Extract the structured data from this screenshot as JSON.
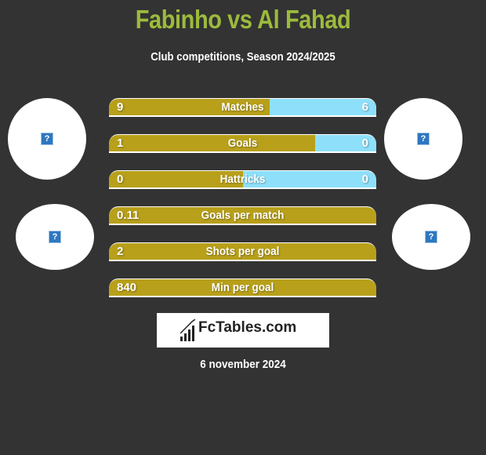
{
  "header": {
    "title": "Fabinho vs Al Fahad",
    "subtitle": "Club competitions, Season 2024/2025"
  },
  "players": {
    "left": {
      "name": "Fabinho",
      "avatar_icon": "missing-image-icon",
      "club_icon": "missing-image-icon"
    },
    "right": {
      "name": "Al Fahad",
      "avatar_icon": "missing-image-icon",
      "club_icon": "missing-image-icon"
    }
  },
  "colors": {
    "left": "#b8a01a",
    "right": "#8ee0fa",
    "title": "#9cbb3c",
    "background": "#333333"
  },
  "stats": [
    {
      "label": "Matches",
      "left": "9",
      "right": "6",
      "left_share": 0.6
    },
    {
      "label": "Goals",
      "left": "1",
      "right": "0",
      "left_share": 0.77
    },
    {
      "label": "Hattricks",
      "left": "0",
      "right": "0",
      "left_share": 0.5
    },
    {
      "label": "Goals per match",
      "left": "0.11",
      "right": "",
      "left_share": 1
    },
    {
      "label": "Shots per goal",
      "left": "2",
      "right": "",
      "left_share": 1
    },
    {
      "label": "Min per goal",
      "left": "840",
      "right": "",
      "left_share": 1
    }
  ],
  "logo": {
    "text": "FcTables.com",
    "icon": "bar-chart-icon"
  },
  "date": "6 november 2024"
}
